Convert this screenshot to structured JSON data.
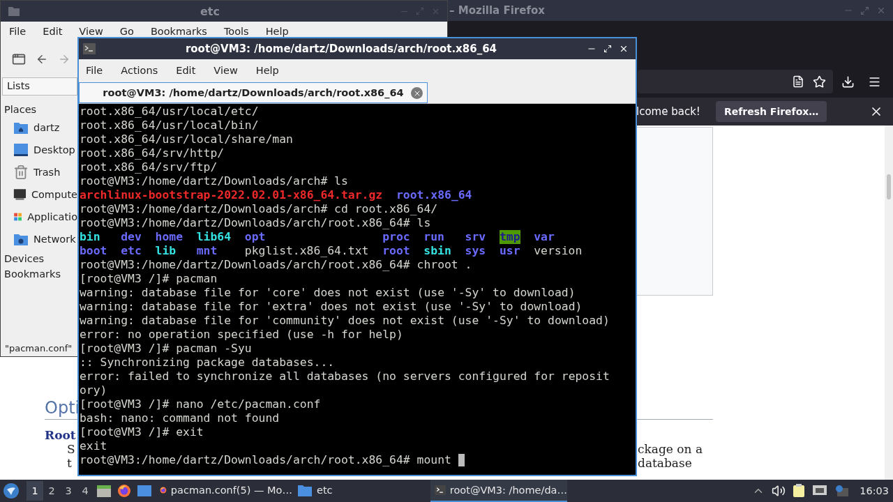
{
  "firefox": {
    "title": "– Mozilla Firefox",
    "notification": {
      "message": "lcome back!",
      "button": "Refresh Firefox…"
    },
    "page": {
      "heading": "Opti",
      "subheading": "Root",
      "lines": [
        {
          "left": "S",
          "right": "ckage on a"
        },
        {
          "left": "t",
          "right": "database"
        }
      ]
    }
  },
  "file_manager": {
    "title": "etc",
    "menu": [
      "File",
      "Edit",
      "View",
      "Go",
      "Bookmarks",
      "Tools",
      "Help"
    ],
    "pane_selector": "Lists",
    "sections": [
      {
        "label": "Places",
        "items": [
          {
            "kind": "home",
            "label": "dartz"
          },
          {
            "kind": "desktop",
            "label": "Desktop"
          },
          {
            "kind": "trash",
            "label": "Trash"
          },
          {
            "kind": "computer",
            "label": "Compute"
          },
          {
            "kind": "applications",
            "label": "Applicatio"
          },
          {
            "kind": "network",
            "label": "Network"
          }
        ]
      },
      {
        "label": "Devices"
      },
      {
        "label": "Bookmarks"
      }
    ],
    "status": "\"pacman.conf\""
  },
  "terminal": {
    "title": "root@VM3: /home/dartz/Downloads/arch/root.x86_64",
    "menu": [
      "File",
      "Actions",
      "Edit",
      "View",
      "Help"
    ],
    "tabs": [
      {
        "label": "root@VM3: /home/dartz/Downloads/arch/root.x86_64",
        "selected": true
      }
    ],
    "lines": [
      {
        "kind": "text",
        "text": "root.x86_64/usr/local/etc/"
      },
      {
        "kind": "text",
        "text": "root.x86_64/usr/local/bin/"
      },
      {
        "kind": "text",
        "text": "root.x86_64/usr/local/share/man"
      },
      {
        "kind": "text",
        "text": "root.x86_64/srv/http/"
      },
      {
        "kind": "text",
        "text": "root.x86_64/srv/ftp/"
      },
      {
        "kind": "text",
        "text": "root@VM3:/home/dartz/Downloads/arch# ls"
      },
      {
        "kind": "listing",
        "items": [
          {
            "kind": "archive",
            "text": "archlinux-bootstrap-2022.02.01-x86_64.tar.gz"
          },
          {
            "kind": "dir",
            "text": "root.x86_64"
          }
        ]
      },
      {
        "kind": "text",
        "text": "root@VM3:/home/dartz/Downloads/arch# cd root.x86_64/"
      },
      {
        "kind": "text",
        "text": "root@VM3:/home/dartz/Downloads/arch/root.x86_64# ls"
      },
      {
        "kind": "columns",
        "items": [
          {
            "kind": "link",
            "text": "bin"
          },
          {
            "kind": "dir",
            "text": "dev"
          },
          {
            "kind": "dir",
            "text": "home"
          },
          {
            "kind": "link",
            "text": "lib64"
          },
          {
            "kind": "dir",
            "text": "opt"
          },
          {
            "kind": "dir",
            "text": "proc"
          },
          {
            "kind": "dir",
            "text": "run"
          },
          {
            "kind": "dir",
            "text": "srv"
          },
          {
            "kind": "sticky",
            "text": "tmp"
          },
          {
            "kind": "dir",
            "text": "var"
          }
        ]
      },
      {
        "kind": "columns",
        "items": [
          {
            "kind": "dir",
            "text": "boot"
          },
          {
            "kind": "dir",
            "text": "etc"
          },
          {
            "kind": "link",
            "text": "lib"
          },
          {
            "kind": "dir",
            "text": "mnt"
          },
          {
            "kind": "file",
            "text": "pkglist.x86_64.txt"
          },
          {
            "kind": "dir",
            "text": "root"
          },
          {
            "kind": "link",
            "text": "sbin"
          },
          {
            "kind": "dir",
            "text": "sys"
          },
          {
            "kind": "dir",
            "text": "usr"
          },
          {
            "kind": "file",
            "text": "version"
          }
        ]
      },
      {
        "kind": "text",
        "text": "root@VM3:/home/dartz/Downloads/arch/root.x86_64# chroot ."
      },
      {
        "kind": "text",
        "text": "[root@VM3 /]# pacman"
      },
      {
        "kind": "text",
        "text": "warning: database file for 'core' does not exist (use '-Sy' to download)"
      },
      {
        "kind": "text",
        "text": "warning: database file for 'extra' does not exist (use '-Sy' to download)"
      },
      {
        "kind": "text",
        "text": "warning: database file for 'community' does not exist (use '-Sy' to download)"
      },
      {
        "kind": "text",
        "text": "error: no operation specified (use -h for help)"
      },
      {
        "kind": "text",
        "text": "[root@VM3 /]# pacman -Syu"
      },
      {
        "kind": "text",
        "text": ":: Synchronizing package databases..."
      },
      {
        "kind": "text",
        "text": "error: failed to synchronize all databases (no servers configured for reposit"
      },
      {
        "kind": "text",
        "text": "ory)"
      },
      {
        "kind": "text",
        "text": "[root@VM3 /]# nano /etc/pacman.conf"
      },
      {
        "kind": "text",
        "text": "bash: nano: command not found"
      },
      {
        "kind": "text",
        "text": "[root@VM3 /]# exit"
      },
      {
        "kind": "text",
        "text": "exit"
      },
      {
        "kind": "text",
        "text": "root@VM3:/home/dartz/Downloads/arch/root.x86_64# mount",
        "cursor": true
      }
    ]
  },
  "taskbar": {
    "workspaces": [
      {
        "label": "1",
        "selected": true
      },
      {
        "label": "2",
        "selected": false
      },
      {
        "label": "3",
        "selected": false
      },
      {
        "label": "4",
        "selected": false
      }
    ],
    "tasks": [
      {
        "kind": "browser",
        "label": "pacman.conf(5) — Mo…",
        "selected": false
      },
      {
        "kind": "folder",
        "label": "etc",
        "selected": false
      },
      {
        "kind": "terminal",
        "label": "root@VM3: /home/da…",
        "selected": true
      }
    ],
    "clock": "16:03"
  }
}
